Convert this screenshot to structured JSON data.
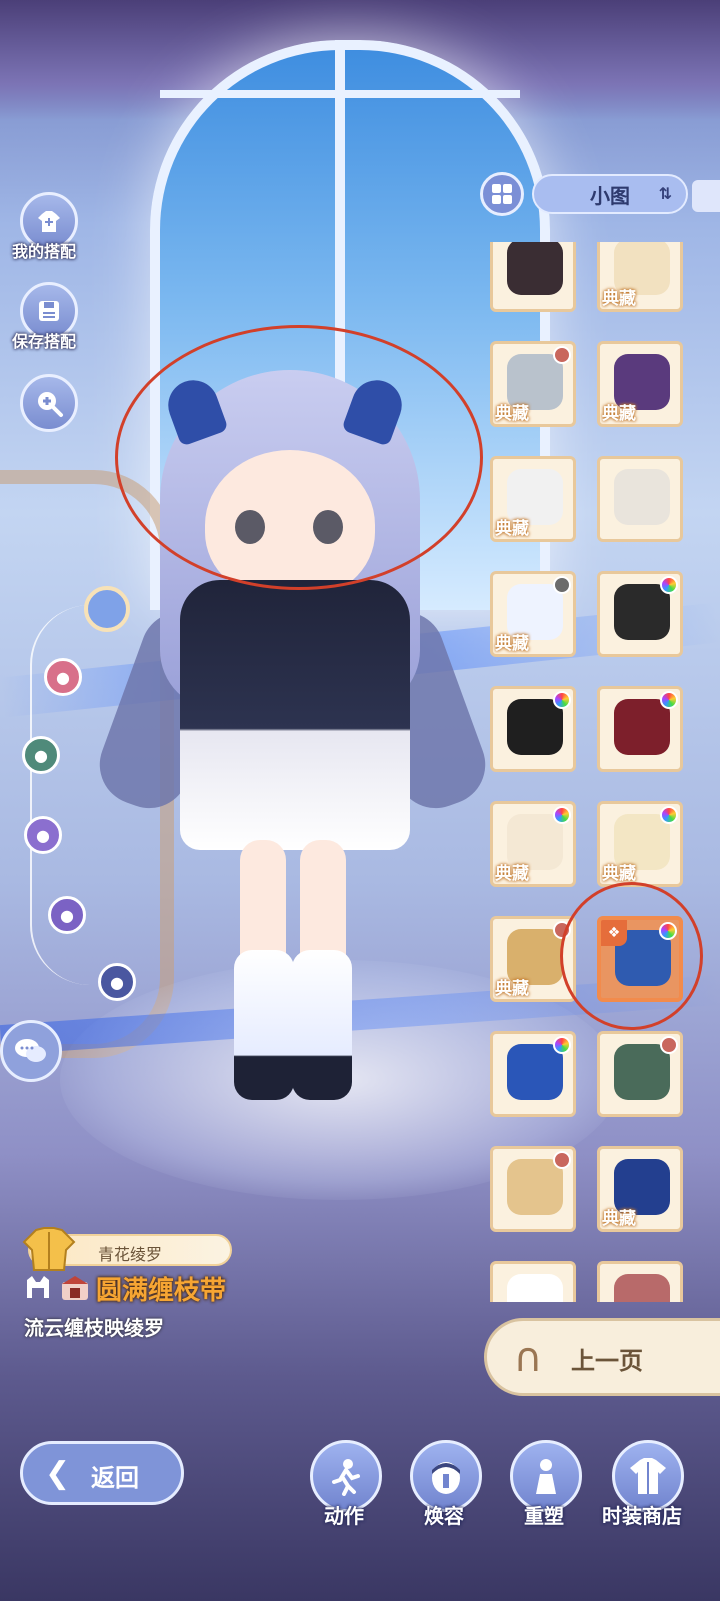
{
  "sidebar": {
    "my_outfits": "我的搭配",
    "save_outfit": "保存搭配"
  },
  "toolbar": {
    "view_mode": "小图"
  },
  "items": [
    {
      "tag": "",
      "dot": ""
    },
    {
      "tag": "典藏",
      "dot": ""
    },
    {
      "tag": "典藏",
      "dot": "#c9675d"
    },
    {
      "tag": "典藏",
      "dot": ""
    },
    {
      "tag": "典藏",
      "dot": ""
    },
    {
      "tag": "",
      "dot": ""
    },
    {
      "tag": "典藏",
      "dot": "#6b6b6b"
    },
    {
      "tag": "",
      "dot": "rainbow"
    },
    {
      "tag": "",
      "dot": "rainbow"
    },
    {
      "tag": "",
      "dot": "rainbow"
    },
    {
      "tag": "典藏",
      "dot": "rainbow"
    },
    {
      "tag": "典藏",
      "dot": "rainbow"
    },
    {
      "tag": "典藏",
      "dot": "#c9675d"
    },
    {
      "tag": "",
      "dot": "rainbow",
      "selected": true
    },
    {
      "tag": "",
      "dot": "rainbow"
    },
    {
      "tag": "",
      "dot": "#c9675d"
    },
    {
      "tag": "",
      "dot": "#c9675d"
    },
    {
      "tag": "典藏",
      "dot": ""
    },
    {
      "tag": "",
      "dot": ""
    },
    {
      "tag": "",
      "dot": ""
    }
  ],
  "pager": {
    "prev_label": "上一页"
  },
  "outfit": {
    "set_name": "青花绫罗",
    "item_name": "圆满缠枝带",
    "description": "流云缠枝映绫罗"
  },
  "nav": {
    "back": "返回",
    "action": "动作",
    "makeover": "焕容",
    "reshape": "重塑",
    "shop": "时装商店"
  },
  "colors": {
    "accent": "#7f94d8",
    "gold_text": "#f6a533",
    "highlight": "#d2402a"
  }
}
